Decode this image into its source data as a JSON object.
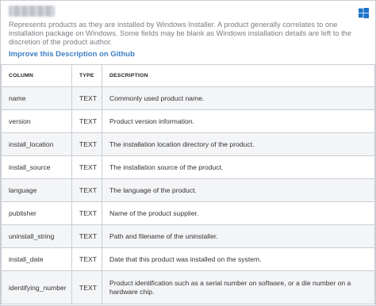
{
  "description": "Represents products as they are installed by Windows Installer. A product generally correlates to one installation package on Windows. Some fields may be blank as Windows installation details are left to the discretion of the product author.",
  "link_label": "Improve this Description on Github",
  "icons": {
    "platform": "windows-logo-icon"
  },
  "colors": {
    "link": "#3d7fc4",
    "windows": "#1a73c9",
    "row_alt": "#f4f5f7",
    "border": "#c9ced4"
  },
  "table": {
    "headers": [
      "COLUMN",
      "TYPE",
      "DESCRIPTION"
    ],
    "rows": [
      {
        "column": "name",
        "type": "TEXT",
        "description": "Commonly used product name."
      },
      {
        "column": "version",
        "type": "TEXT",
        "description": "Product version information."
      },
      {
        "column": "install_location",
        "type": "TEXT",
        "description": "The installation location directory of the product."
      },
      {
        "column": "install_source",
        "type": "TEXT",
        "description": "The installation source of the product."
      },
      {
        "column": "language",
        "type": "TEXT",
        "description": "The language of the product."
      },
      {
        "column": "publisher",
        "type": "TEXT",
        "description": "Name of the product supplier."
      },
      {
        "column": "uninstall_string",
        "type": "TEXT",
        "description": "Path and filename of the uninstaller."
      },
      {
        "column": "install_date",
        "type": "TEXT",
        "description": "Date that this product was installed on the system."
      },
      {
        "column": "identifying_number",
        "type": "TEXT",
        "description": "Product identification such as a serial number on software, or a die number on a hardware chip."
      }
    ]
  }
}
